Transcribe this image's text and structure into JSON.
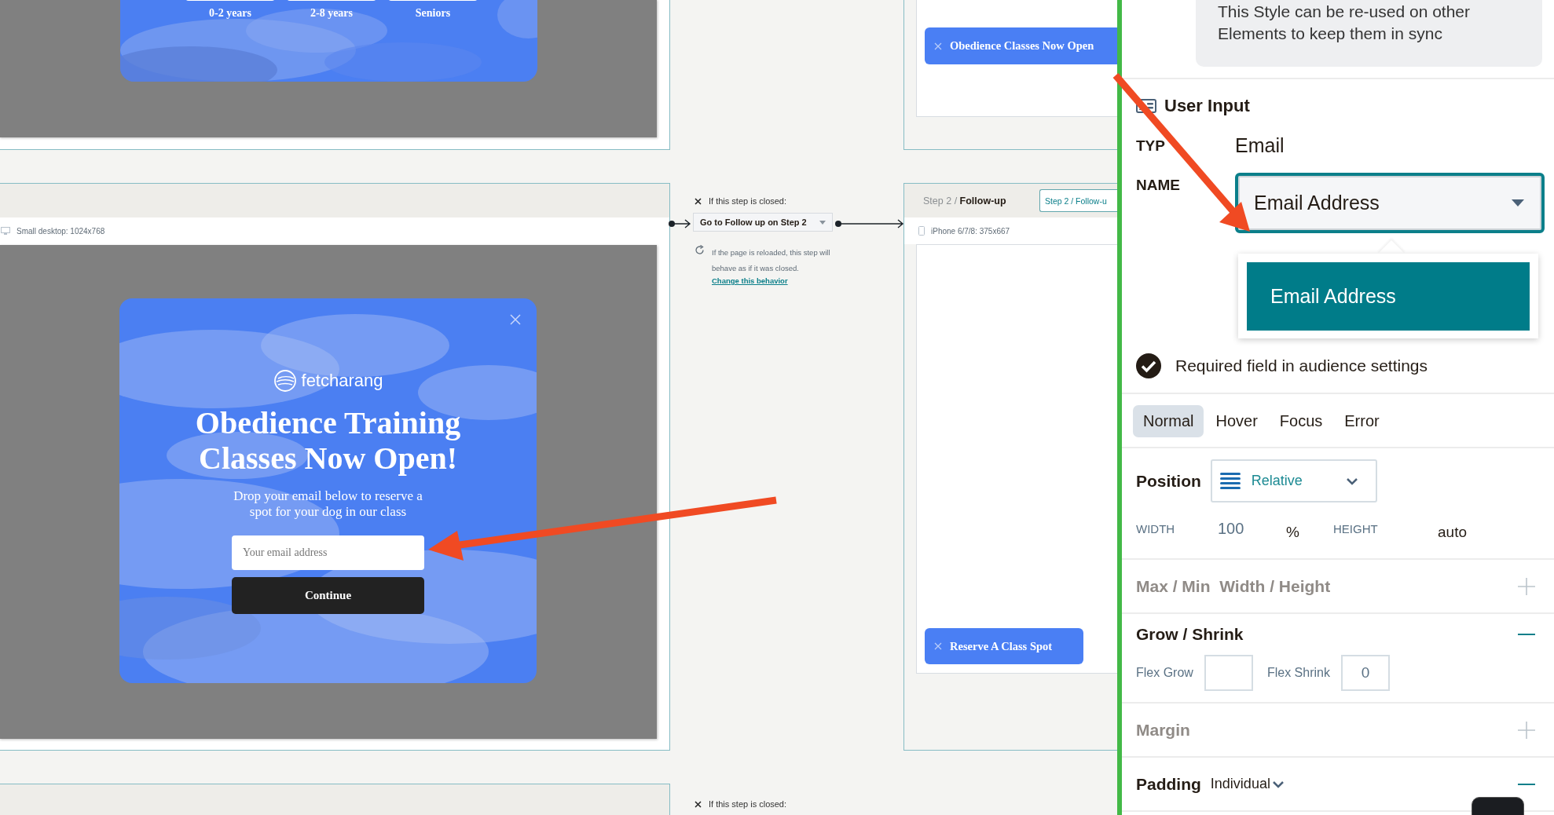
{
  "canvas": {
    "top_frame": {
      "age_options": [
        "0-2 years",
        "2-8 years",
        "Seniors"
      ]
    },
    "desktop_frame": {
      "device_label": "Small desktop: 1024x768",
      "popup": {
        "brand": "fetcharang",
        "title": "Obedience Training Classes Now Open!",
        "subtitle": "Drop your email below to reserve a spot for your dog in our class",
        "email_placeholder": "Your email address",
        "button": "Continue"
      }
    },
    "connector": {
      "close_label": "If this step is closed:",
      "action": "Go to Follow up on Step 2",
      "reload_note": "If the page is reloaded, this step will behave as if it was closed.",
      "link": "Change this behavior"
    },
    "top_mobile_frame": {
      "button": "Obedience Classes Now Open"
    },
    "followup_frame": {
      "step": "Step 2",
      "separator": "/",
      "name": "Follow-up",
      "tab": "Step 2 / Follow-u",
      "device_label": "iPhone 6/7/8: 375x667",
      "button": "Reserve A Class Spot"
    },
    "bottom_connector": {
      "close_label": "If this step is closed:"
    }
  },
  "panel": {
    "style_note": "This Style can be re-used on other Elements to keep them in sync",
    "section_title": "User Input",
    "type_label": "TYP",
    "type_value": "Email",
    "name_label": "NAME",
    "name_value": "Email Address",
    "dropdown_options": [
      {
        "label": "Email Address",
        "selected": true
      }
    ],
    "required": {
      "label": "Required field in audience settings",
      "checked": true
    },
    "state_tabs": [
      {
        "label": "Normal",
        "selected": true
      },
      {
        "label": "Hover",
        "selected": false
      },
      {
        "label": "Focus",
        "selected": false
      },
      {
        "label": "Error",
        "selected": false
      }
    ],
    "position": {
      "label": "Position",
      "value": "Relative"
    },
    "size": {
      "width_label": "WIDTH",
      "width_value": "100",
      "width_unit": "%",
      "height_label": "HEIGHT",
      "height_value": "auto"
    },
    "sections": [
      {
        "kind": "plain",
        "title": "Max / Min  Width / Height",
        "expanded": false
      },
      {
        "kind": "flex",
        "title": "Grow / Shrink",
        "expanded": true,
        "grow_label": "Flex Grow",
        "shrink_label": "Flex Shrink",
        "shrink_value": "0"
      },
      {
        "kind": "plain",
        "title": "Margin",
        "expanded": false
      },
      {
        "kind": "padding",
        "title": "Padding",
        "expanded": true,
        "mode": "Individual"
      }
    ]
  }
}
